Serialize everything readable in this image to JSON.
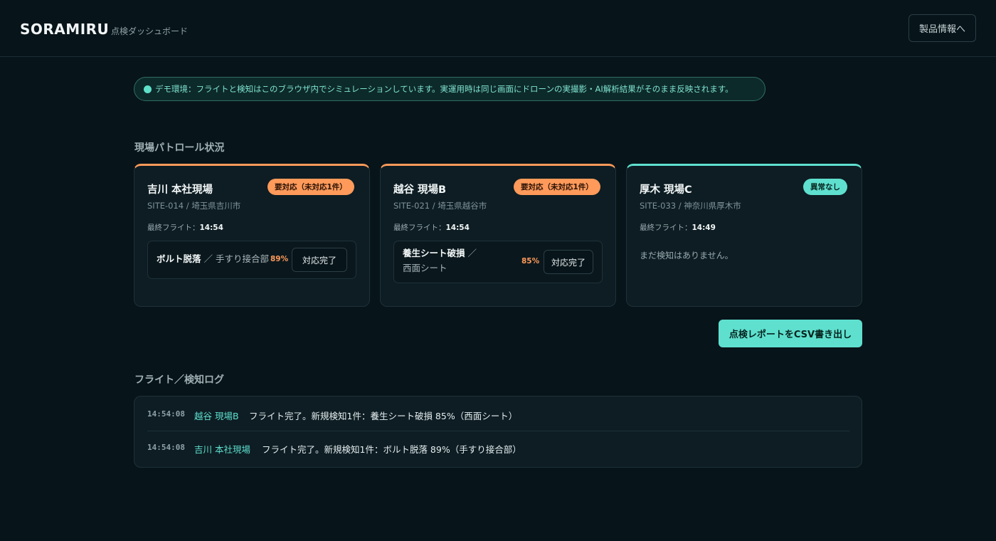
{
  "header": {
    "brand": "SORAMIRU",
    "subtitle": "点検ダッシュボード",
    "product_button": "製品情報へ"
  },
  "notice": {
    "text": "デモ環境：フライトと検知はこのブラウザ内でシミュレーションしています。実運用時は同じ画面にドローンの実撮影・AI解析結果がそのまま反映されます。"
  },
  "patrol": {
    "title": "現場パトロール状況",
    "flight_label": "最終フライト：",
    "resolve_label": "対応完了",
    "sites": [
      {
        "name": "吉川 本社現場",
        "badge": "要対応（未対応1件）",
        "status": "alert",
        "meta": "SITE-014 / 埼玉県吉川市",
        "last_flight": "14:54",
        "detection": {
          "label": "ボルト脱落",
          "location": "／ 手すり接合部",
          "confidence": "89%"
        }
      },
      {
        "name": "越谷 現場B",
        "badge": "要対応（未対応1件）",
        "status": "alert",
        "meta": "SITE-021 / 埼玉県越谷市",
        "last_flight": "14:54",
        "detection": {
          "label": "養生シート破損",
          "location": "／",
          "location2": "西面シート",
          "confidence": "85%"
        }
      },
      {
        "name": "厚木 現場C",
        "badge": "異常なし",
        "status": "ok",
        "meta": "SITE-033 / 神奈川県厚木市",
        "last_flight": "14:49",
        "empty": "まだ検知はありません。"
      }
    ]
  },
  "csv_button": "点検レポートをCSV書き出し",
  "log": {
    "title": "フライト／検知ログ",
    "entries": [
      {
        "time": "14:54:08",
        "site": "越谷 現場B",
        "message": "フライト完了。新規検知1件：養生シート破損 85%（西面シート）"
      },
      {
        "time": "14:54:08",
        "site": "吉川 本社現場",
        "message": "フライト完了。新規検知1件：ボルト脱落 89%（手すり接合部）"
      }
    ]
  },
  "colors": {
    "background": "#071419",
    "accent": "#5fe0cf",
    "alert": "#ff9a5a"
  }
}
